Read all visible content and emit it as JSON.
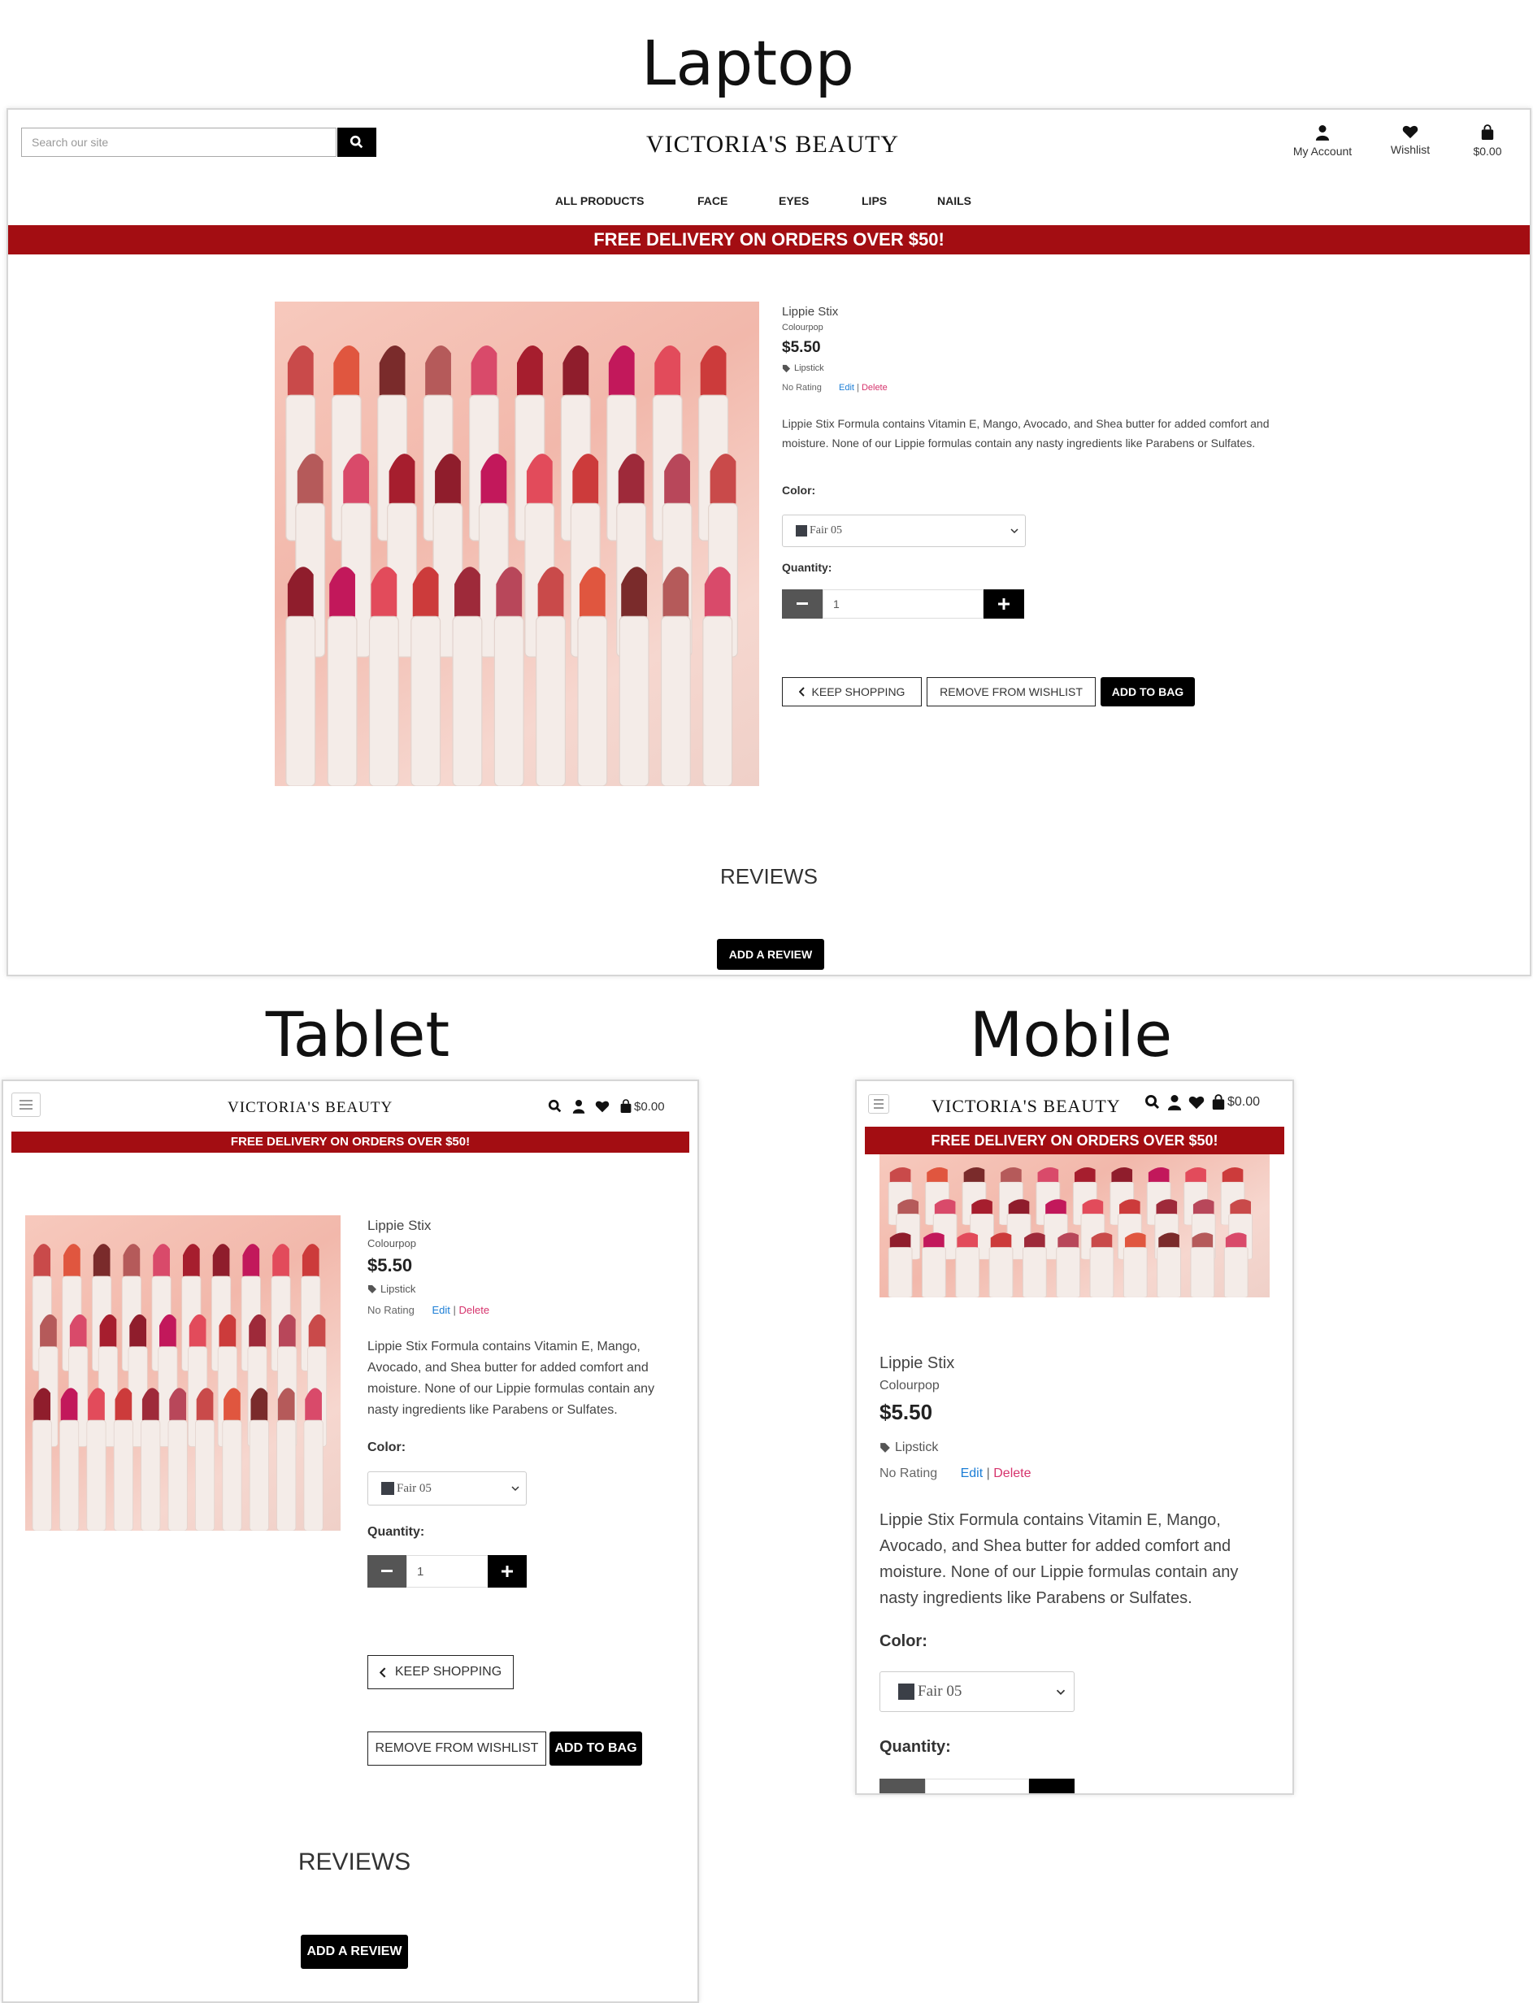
{
  "captions": {
    "laptop": "Laptop",
    "tablet": "Tablet",
    "mobile": "Mobile"
  },
  "brand": {
    "logo": "VICTORIA'S BEAUTY",
    "banner_color": "#a30d12"
  },
  "header": {
    "search_placeholder": "Search our site",
    "my_account": "My Account",
    "wishlist": "Wishlist",
    "bag_total": "$0.00"
  },
  "nav": [
    "ALL PRODUCTS",
    "FACE",
    "EYES",
    "LIPS",
    "NAILS"
  ],
  "banner_text": "FREE DELIVERY ON ORDERS OVER $50!",
  "product": {
    "name": "Lippie Stix",
    "brand": "Colourpop",
    "price": "$5.50",
    "category": "Lipstick",
    "rating": "No Rating",
    "edit": "Edit",
    "separator": "|",
    "delete": "Delete",
    "description": "Lippie Stix Formula contains Vitamin E, Mango, Avocado, and Shea butter for added comfort and moisture. None of our Lippie formulas contain any nasty ingredients like Parabens or Sulfates.",
    "color_label": "Color:",
    "color_value": "Fair 05",
    "quantity_label": "Quantity:",
    "quantity_value": "1"
  },
  "buttons": {
    "keep_shopping": "KEEP SHOPPING",
    "remove_wishlist": "REMOVE FROM WISHLIST",
    "add_to_bag": "ADD TO BAG",
    "add_review": "ADD A REVIEW"
  },
  "reviews_title": "REVIEWS",
  "icons": [
    "search-icon",
    "user-icon",
    "heart-icon",
    "bag-icon",
    "tag-icon",
    "chevron-left-icon",
    "chevron-down-icon",
    "minus-icon",
    "plus-icon",
    "menu-icon"
  ]
}
